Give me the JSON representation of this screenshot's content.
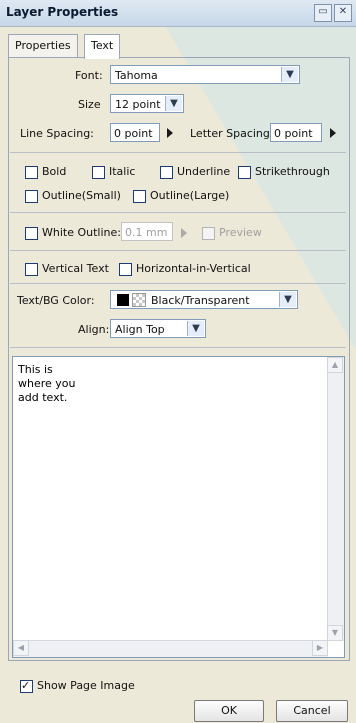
{
  "window": {
    "title": "Layer Properties",
    "minimize_glyph": "▭",
    "close_glyph": "✕"
  },
  "tabs": [
    {
      "label": "Properties"
    },
    {
      "label": "Text",
      "active": true
    }
  ],
  "font": {
    "label": "Font:",
    "value": "Tahoma"
  },
  "size": {
    "label": "Size",
    "value": "12 point"
  },
  "line_spacing": {
    "label": "Line Spacing:",
    "value": "0 point"
  },
  "letter_spacing": {
    "label": "Letter Spacing:",
    "value": "0 point"
  },
  "styles": {
    "bold": "Bold",
    "italic": "Italic",
    "underline": "Underline",
    "strikethrough": "Strikethrough",
    "outline_small": "Outline(Small)",
    "outline_large": "Outline(Large)"
  },
  "white_outline": {
    "label": "White Outline:",
    "value": "0.1 mm",
    "preview": "Preview"
  },
  "vertical": {
    "vertical_text": "Vertical Text",
    "horizontal_in_vertical": "Horizontal-in-Vertical"
  },
  "color": {
    "label": "Text/BG Color:",
    "value": "Black/Transparent"
  },
  "align": {
    "label": "Align:",
    "value": "Align Top"
  },
  "text_area": {
    "content": "This is\nwhere you\nadd text."
  },
  "show_page_image": {
    "label": "Show Page Image",
    "checked": true
  },
  "buttons": {
    "ok": "OK",
    "cancel": "Cancel"
  },
  "colors": {
    "accent_wedge": "#cfe6ea",
    "panel_bg": "#ece9d8",
    "input_border": "#7f9db9"
  },
  "icons": {
    "dropdown": "chevron-down-icon",
    "spacing_arrow": "triangle-right-icon",
    "scroll_up": "scroll-up-icon",
    "scroll_down": "scroll-down-icon",
    "scroll_left": "scroll-left-icon",
    "scroll_right": "scroll-right-icon"
  }
}
